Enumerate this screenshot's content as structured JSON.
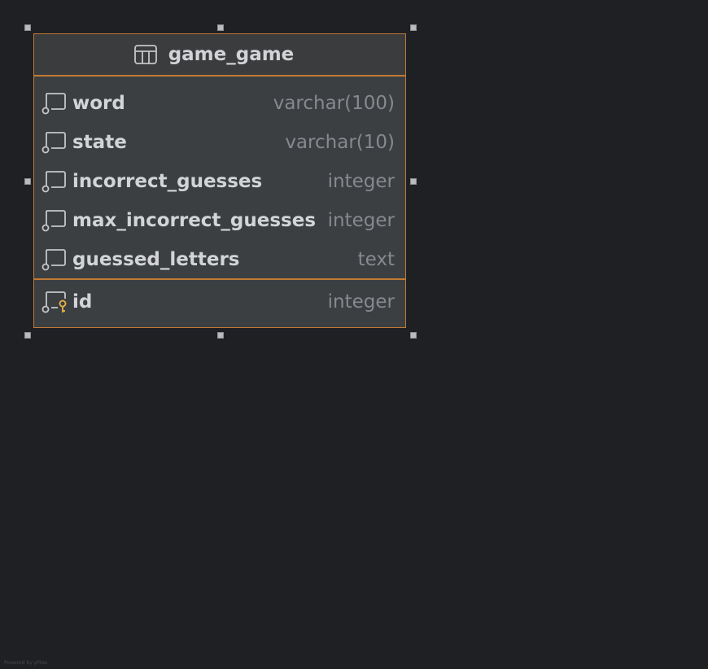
{
  "table": {
    "name": "game_game",
    "icon": "table-icon",
    "columns": [
      {
        "name": "word",
        "type": "varchar(100)",
        "icon": "column-icon"
      },
      {
        "name": "state",
        "type": "varchar(10)",
        "icon": "column-icon"
      },
      {
        "name": "incorrect_guesses",
        "type": "integer",
        "icon": "column-icon"
      },
      {
        "name": "max_incorrect_guesses",
        "type": "integer",
        "icon": "column-icon"
      },
      {
        "name": "guessed_letters",
        "type": "text",
        "icon": "column-icon"
      }
    ],
    "primary_key": {
      "name": "id",
      "type": "integer",
      "icon": "primary-key-column-icon"
    }
  },
  "footer": {
    "text": "Powered by yFiles"
  },
  "colors": {
    "background": "#1f2023",
    "node_fill": "#3c3f42",
    "selection_border": "#c27a34",
    "key_icon": "#e8b447",
    "name_text": "#d2d4d7",
    "type_text": "#86898d"
  }
}
